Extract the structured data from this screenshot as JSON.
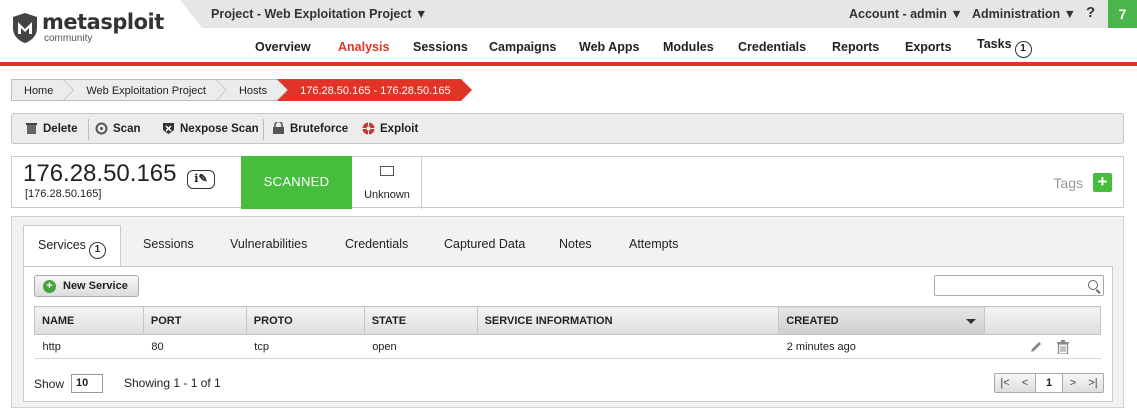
{
  "header": {
    "logo_main": "metasploit",
    "logo_sub": "community",
    "project": "Project - Web Exploitation Project ▼",
    "account": "Account - admin ▼",
    "administration": "Administration ▼",
    "help": "?",
    "notification_count": "7",
    "nav": [
      {
        "label": "Overview"
      },
      {
        "label": "Analysis"
      },
      {
        "label": "Sessions"
      },
      {
        "label": "Campaigns"
      },
      {
        "label": "Web Apps"
      },
      {
        "label": "Modules"
      },
      {
        "label": "Credentials"
      },
      {
        "label": "Reports"
      },
      {
        "label": "Exports"
      },
      {
        "label": "Tasks",
        "badge": "1"
      }
    ],
    "active_nav": "Analysis",
    "accent_color": "#e03426"
  },
  "breadcrumb": [
    "Home",
    "Web Exploitation Project",
    "Hosts",
    "176.28.50.165 - 176.28.50.165"
  ],
  "toolbar": {
    "delete": "Delete",
    "scan": "Scan",
    "nexpose": "Nexpose Scan",
    "bruteforce": "Bruteforce",
    "exploit": "Exploit"
  },
  "host": {
    "ip": "176.28.50.165",
    "ip_sub": "[176.28.50.165]",
    "info_icon": "i",
    "status": "SCANNED",
    "status_color": "#47bd3e",
    "os": "Unknown",
    "tags_label": "Tags",
    "tags_add": "+"
  },
  "tabs": [
    {
      "label": "Services",
      "badge": "1"
    },
    {
      "label": "Sessions"
    },
    {
      "label": "Vulnerabilities"
    },
    {
      "label": "Credentials"
    },
    {
      "label": "Captured Data"
    },
    {
      "label": "Notes"
    },
    {
      "label": "Attempts"
    }
  ],
  "services": {
    "new_button": "New Service",
    "search_placeholder": "",
    "columns": [
      "NAME",
      "PORT",
      "PROTO",
      "STATE",
      "SERVICE INFORMATION",
      "CREATED"
    ],
    "rows": [
      {
        "name": "http",
        "port": "80",
        "proto": "tcp",
        "state": "open",
        "info": "",
        "created": "2 minutes ago"
      }
    ],
    "show_label": "Show",
    "show_value": "10",
    "showing": "Showing 1 - 1 of 1",
    "page": "1"
  }
}
